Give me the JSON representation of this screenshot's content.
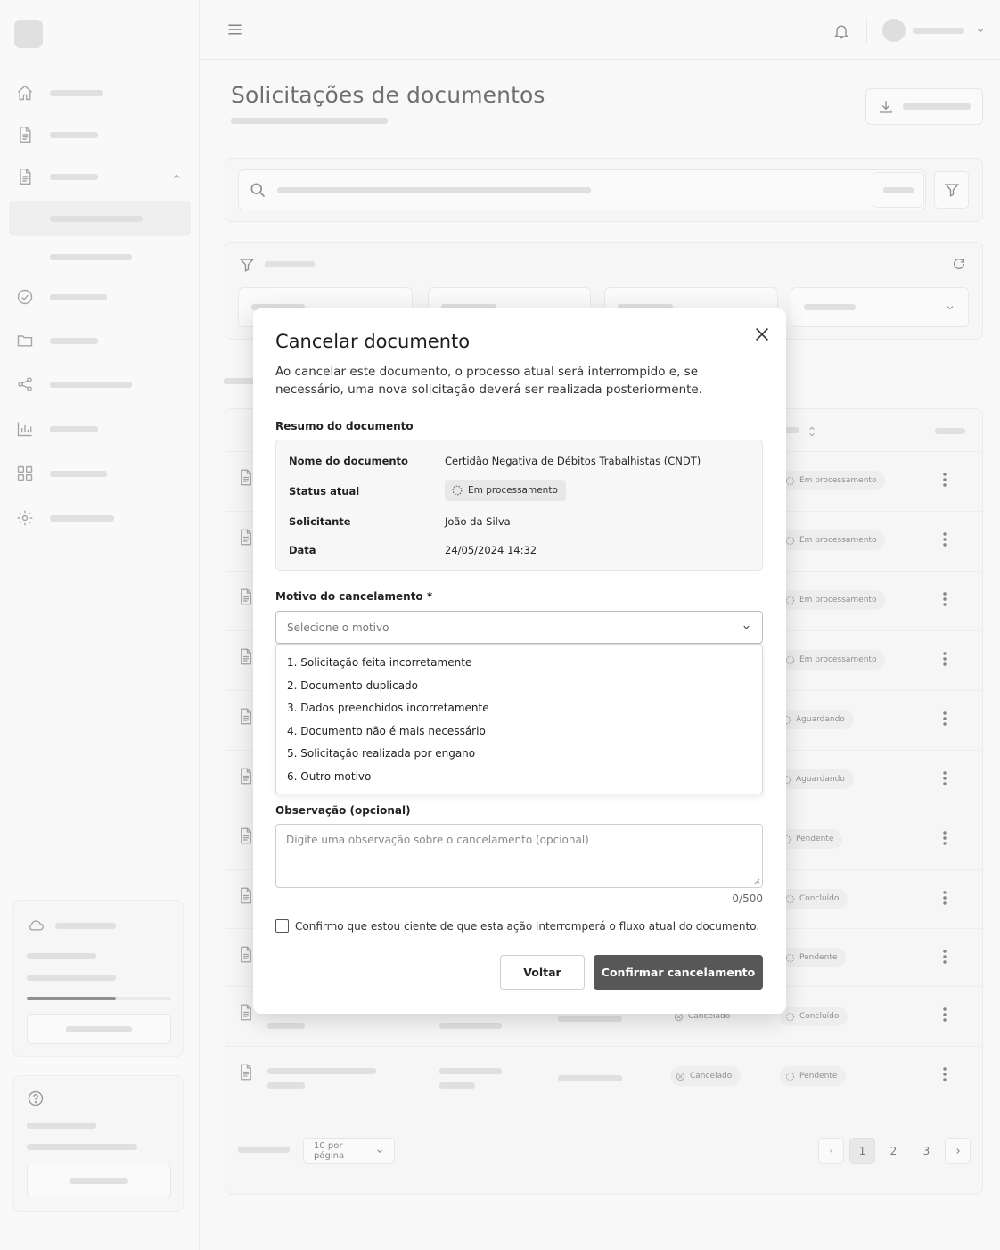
{
  "page": {
    "title": "Solicitações de documentos"
  },
  "table": {
    "rows": [
      {
        "status": "Em processamento"
      },
      {
        "status": "Em processamento"
      },
      {
        "status": "Em processamento"
      },
      {
        "status": "Em processamento"
      },
      {
        "status": "Aguardando"
      },
      {
        "status": "Aguardando"
      },
      {
        "status": "Pendente"
      },
      {
        "status": "Concluído"
      },
      {
        "status": "Pendente"
      },
      {
        "secondary_status": "Cancelado",
        "status": "Concluído"
      },
      {
        "secondary_status": "Cancelado",
        "status": "Pendente"
      }
    ]
  },
  "pagination": {
    "per_page": "10 por página",
    "pages": [
      "1",
      "2",
      "3"
    ],
    "current": "1"
  },
  "modal": {
    "title": "Cancelar documento",
    "description": "Ao cancelar este documento, o processo atual será interrompido e, se necessário, uma nova solicitação deverá ser realizada posteriormente.",
    "summary_label": "Resumo do documento",
    "summary": {
      "name_key": "Nome do documento",
      "name_value": "Certidão Negativa de Débitos Trabalhistas (CNDT)",
      "status_key": "Status atual",
      "status_value": "Em processamento",
      "requester_key": "Solicitante",
      "requester_value": "João da Silva",
      "date_key": "Data",
      "date_value": "24/05/2024 14:32"
    },
    "reason_label": "Motivo do cancelamento *",
    "reason_placeholder": "Selecione o motivo",
    "reason_options": [
      "1. Solicitação feita incorretamente",
      "2. Documento duplicado",
      "3. Dados preenchidos incorretamente",
      "4. Documento não é mais necessário",
      "5. Solicitação realizada por engano",
      "6. Outro motivo"
    ],
    "note_label": "Observação (opcional)",
    "note_placeholder": "Digite uma observação sobre o cancelamento (opcional)",
    "note_counter": "0/500",
    "confirm_check_label": "Confirmo que estou ciente de que esta ação interromperá o fluxo atual do documento.",
    "back_label": "Voltar",
    "confirm_label": "Confirmar cancelamento"
  }
}
